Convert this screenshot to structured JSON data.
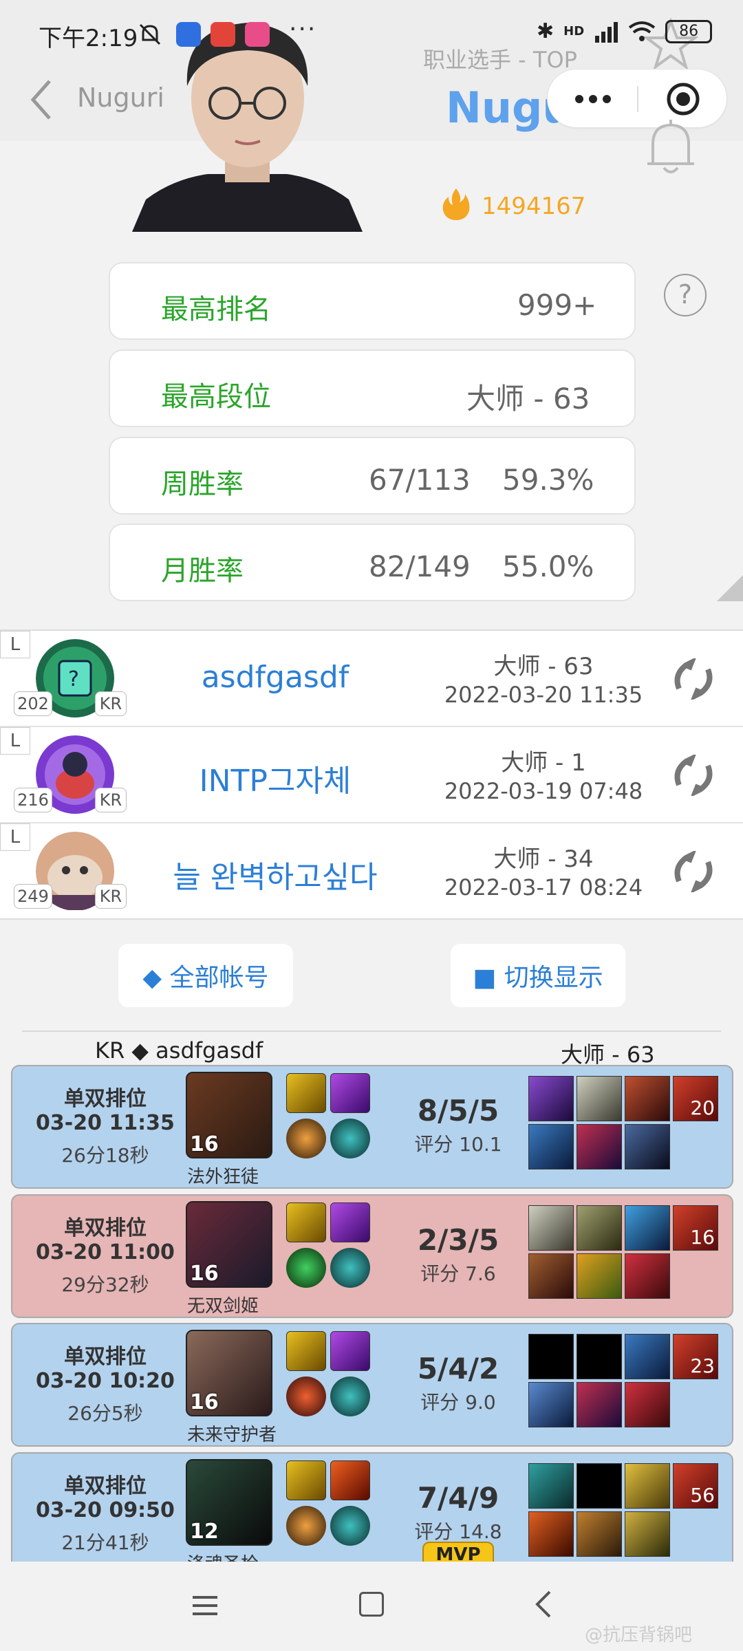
{
  "status_bar": {
    "time": "下午2:19",
    "more": "···",
    "signal": "HD",
    "battery": "86"
  },
  "header": {
    "back_label": "Nuguri",
    "role": "职业选手 - TOP",
    "name": "Nuguri",
    "heat": "1494167"
  },
  "stats": [
    {
      "label": "最高排名",
      "value_a": "",
      "value_b": "999+"
    },
    {
      "label": "最高段位",
      "value_a": "",
      "value_b": "大师 - 63"
    },
    {
      "label": "周胜率",
      "value_a": "67/113",
      "value_b": "59.3%"
    },
    {
      "label": "月胜率",
      "value_a": "82/149",
      "value_b": "55.0%"
    }
  ],
  "help": "?",
  "accounts": [
    {
      "tag": "L",
      "level": "202",
      "region": "KR",
      "name": "asdfgasdf",
      "rank": "大师 - 63",
      "date": "2022-03-20 11:35"
    },
    {
      "tag": "L",
      "level": "216",
      "region": "KR",
      "name": "INTP그자체",
      "rank": "大师 - 1",
      "date": "2022-03-19 07:48"
    },
    {
      "tag": "L",
      "level": "249",
      "region": "KR",
      "name": "늘 완벽하고싶다",
      "rank": "大师 - 34",
      "date": "2022-03-17 08:24"
    }
  ],
  "buttons": {
    "all_accounts": "◆ 全部帐号",
    "toggle_view": "■ 切换显示"
  },
  "match_caption": {
    "account": "KR ◆ asdfgasdf",
    "rank": "大师 - 63"
  },
  "matches": [
    {
      "result": "win",
      "mode": "单双排位",
      "time": "03-20 11:35",
      "duration": "26分18秒",
      "champ_level": "16",
      "champ_name": "法外狂徒",
      "kda": "8/5/5",
      "score": "评分 10.1",
      "mvp": "",
      "item_level": "20"
    },
    {
      "result": "loss",
      "mode": "单双排位",
      "time": "03-20 11:00",
      "duration": "29分32秒",
      "champ_level": "16",
      "champ_name": "无双剑姬",
      "kda": "2/3/5",
      "score": "评分 7.6",
      "mvp": "",
      "item_level": "16"
    },
    {
      "result": "win",
      "mode": "单双排位",
      "time": "03-20 10:20",
      "duration": "26分5秒",
      "champ_level": "16",
      "champ_name": "未来守护者",
      "kda": "5/4/2",
      "score": "评分 9.0",
      "mvp": "",
      "item_level": "23"
    },
    {
      "result": "win",
      "mode": "单双排位",
      "time": "03-20 09:50",
      "duration": "21分41秒",
      "champ_level": "12",
      "champ_name": "涤魂圣枪",
      "kda": "7/4/9",
      "score": "评分 14.8",
      "mvp": "MVP",
      "item_level": "56"
    }
  ],
  "watermark": "@抗压背锅吧",
  "colors": {
    "accent_blue": "#2b7fd6",
    "name_blue": "#5ea1ec",
    "stat_green": "#2aa52a",
    "heat_orange": "#f5a623",
    "win_bg": "#b3d2ee",
    "loss_bg": "#e6b5b5"
  }
}
